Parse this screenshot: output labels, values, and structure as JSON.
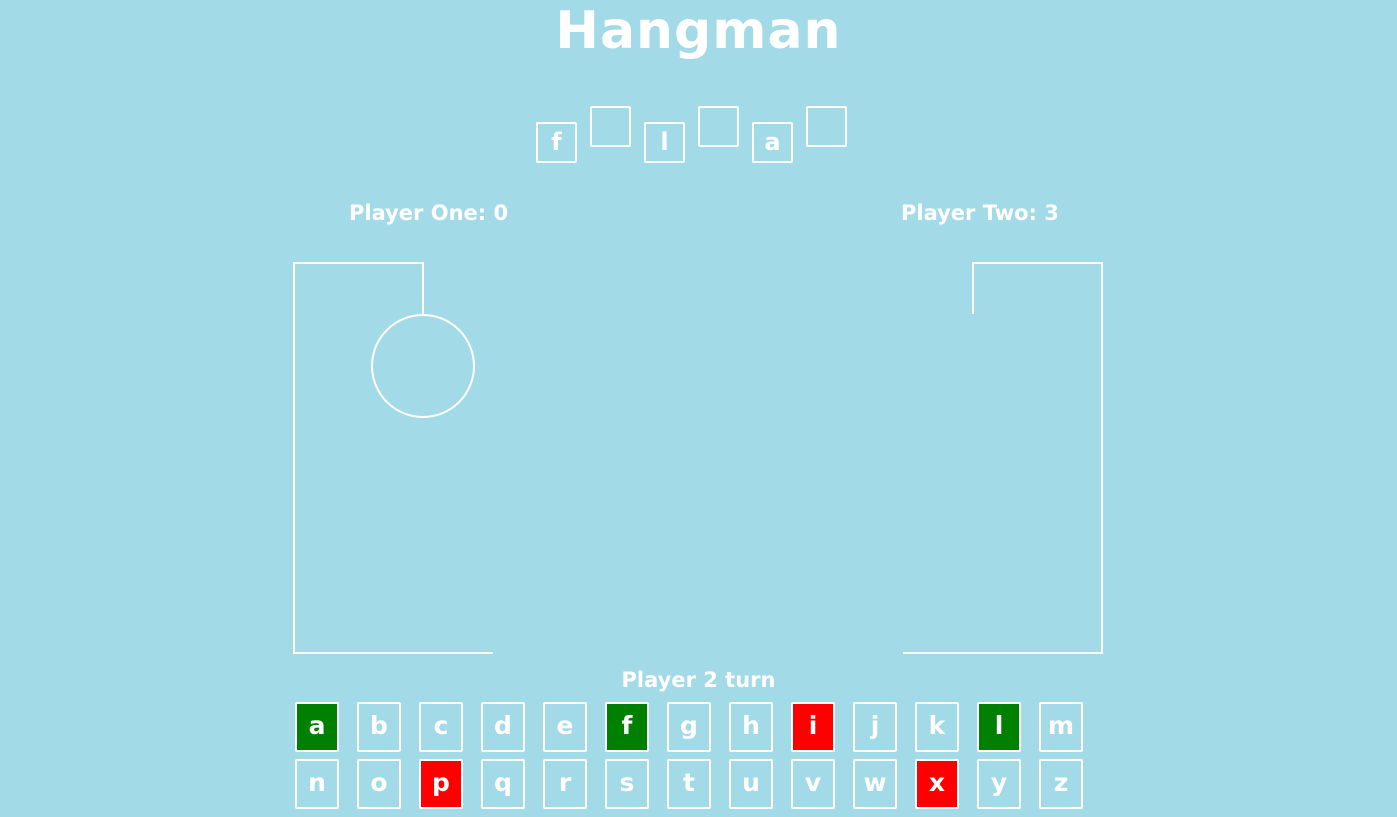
{
  "title": "Hangman",
  "word_slots": [
    {
      "letter": "f"
    },
    {
      "letter": ""
    },
    {
      "letter": "l"
    },
    {
      "letter": ""
    },
    {
      "letter": "a"
    },
    {
      "letter": ""
    }
  ],
  "players": {
    "one": {
      "label": "Player One: 0"
    },
    "two": {
      "label": "Player Two: 3"
    }
  },
  "turn_label": "Player 2 turn",
  "colors": {
    "background": "#a3dae7",
    "foreground": "#ffffff",
    "correct": "#008000",
    "wrong": "#ff0000"
  },
  "keyboard": [
    [
      {
        "letter": "a",
        "state": "correct"
      },
      {
        "letter": "b",
        "state": "unused"
      },
      {
        "letter": "c",
        "state": "unused"
      },
      {
        "letter": "d",
        "state": "unused"
      },
      {
        "letter": "e",
        "state": "unused"
      },
      {
        "letter": "f",
        "state": "correct"
      },
      {
        "letter": "g",
        "state": "unused"
      },
      {
        "letter": "h",
        "state": "unused"
      },
      {
        "letter": "i",
        "state": "wrong"
      },
      {
        "letter": "j",
        "state": "unused"
      },
      {
        "letter": "k",
        "state": "unused"
      },
      {
        "letter": "l",
        "state": "correct"
      },
      {
        "letter": "m",
        "state": "unused"
      }
    ],
    [
      {
        "letter": "n",
        "state": "unused"
      },
      {
        "letter": "o",
        "state": "unused"
      },
      {
        "letter": "p",
        "state": "wrong"
      },
      {
        "letter": "q",
        "state": "unused"
      },
      {
        "letter": "r",
        "state": "unused"
      },
      {
        "letter": "s",
        "state": "unused"
      },
      {
        "letter": "t",
        "state": "unused"
      },
      {
        "letter": "u",
        "state": "unused"
      },
      {
        "letter": "v",
        "state": "unused"
      },
      {
        "letter": "w",
        "state": "unused"
      },
      {
        "letter": "x",
        "state": "wrong"
      },
      {
        "letter": "y",
        "state": "unused"
      },
      {
        "letter": "z",
        "state": "unused"
      }
    ]
  ],
  "gallows": {
    "player_one": {
      "parts_drawn": [
        "gallows",
        "rope",
        "head"
      ]
    },
    "player_two": {
      "parts_drawn": [
        "gallows",
        "rope"
      ]
    }
  }
}
